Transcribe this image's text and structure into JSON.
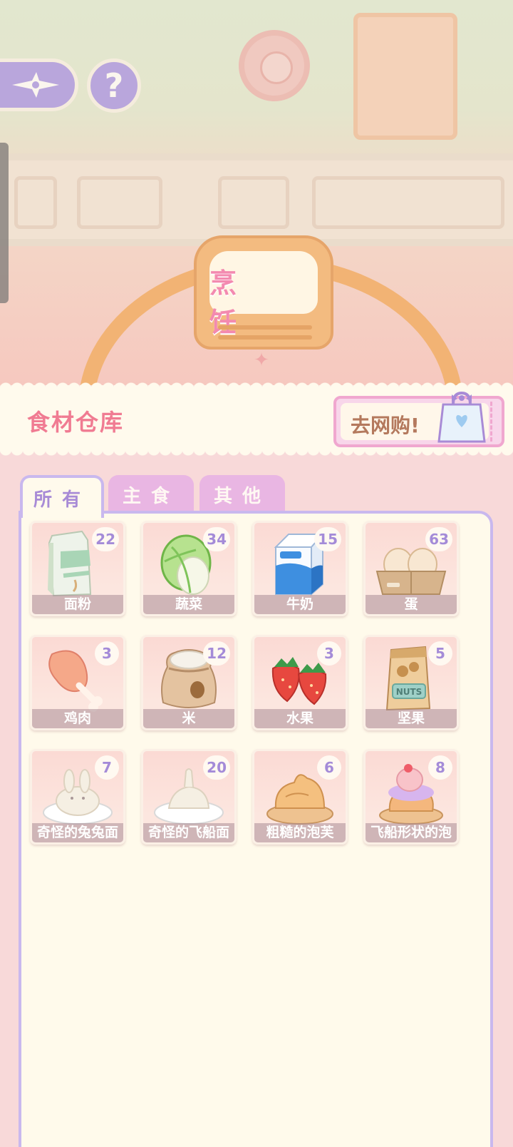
{
  "scene": {
    "station_label": "烹 饪"
  },
  "top_buttons": {
    "back_icon": "star-compass-icon",
    "help_label": "?"
  },
  "header": {
    "title": "食材仓库",
    "shop_label": "去网购!",
    "shop_icon": "shopping-bag-icon"
  },
  "tabs": [
    {
      "label": "所有",
      "active": true
    },
    {
      "label": "主食",
      "active": false
    },
    {
      "label": "其他",
      "active": false
    }
  ],
  "items": [
    {
      "name": "面粉",
      "count": "22",
      "icon": "flour-bag-icon"
    },
    {
      "name": "蔬菜",
      "count": "34",
      "icon": "cabbage-icon"
    },
    {
      "name": "牛奶",
      "count": "15",
      "icon": "milk-carton-icon"
    },
    {
      "name": "蛋",
      "count": "63",
      "icon": "egg-tray-icon"
    },
    {
      "name": "鸡肉",
      "count": "3",
      "icon": "chicken-leg-icon"
    },
    {
      "name": "米",
      "count": "12",
      "icon": "rice-sack-icon"
    },
    {
      "name": "水果",
      "count": "3",
      "icon": "strawberry-icon"
    },
    {
      "name": "坚果",
      "count": "5",
      "icon": "nuts-bag-icon"
    },
    {
      "name": "奇怪的兔兔面",
      "count": "7",
      "icon": "bunny-noodle-icon"
    },
    {
      "name": "奇怪的飞船面",
      "count": "20",
      "icon": "ship-noodle-icon"
    },
    {
      "name": "粗糙的泡芙",
      "count": "6",
      "icon": "rough-puff-icon"
    },
    {
      "name": "飞船形状的泡",
      "count": "8",
      "icon": "ship-puff-icon"
    }
  ],
  "colors": {
    "accent_purple": "#a48bd8",
    "title_pink": "#f07b92",
    "panel_bg": "#fffaeb",
    "page_bg": "#f8d9d9"
  }
}
